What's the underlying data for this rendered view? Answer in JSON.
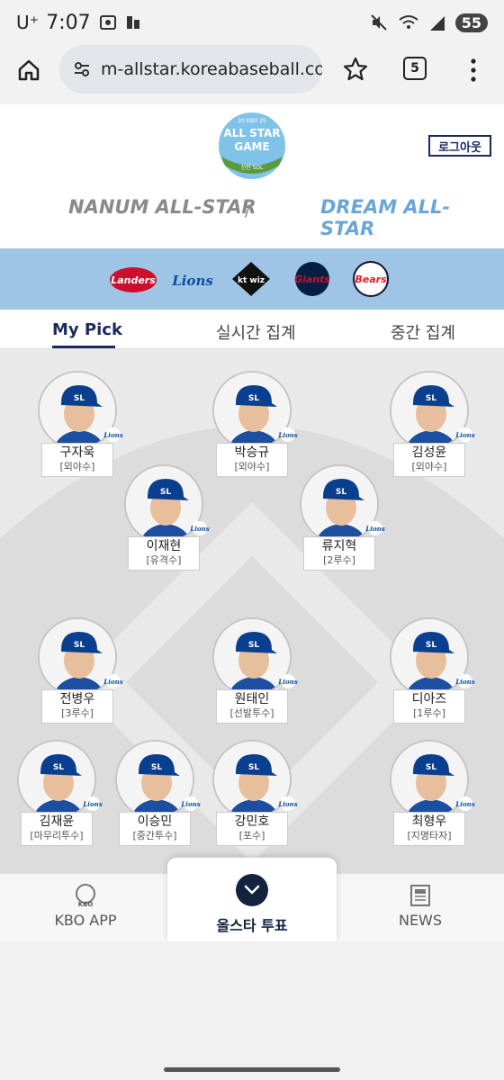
{
  "status_bar": {
    "carrier": "U⁺",
    "time": "7:07",
    "battery": "55"
  },
  "browser": {
    "url": "m-allstar.koreabaseball.com/V",
    "tab_count": "5"
  },
  "header": {
    "logo_top": "20 KBO 25",
    "logo_line1": "ALL STAR",
    "logo_line2": "GAME",
    "logo_sponsor": "신한 SOL",
    "logout_label": "로그아웃",
    "league_nanum": "NANUM ALL-STAR",
    "league_dream": "DREAM ALL-STAR",
    "separator": "/"
  },
  "teams": [
    "Landers",
    "Lions",
    "kt wiz",
    "Giants",
    "Bears"
  ],
  "tabs": {
    "my_pick": "My Pick",
    "realtime": "실시간 집계",
    "interim": "중간 집계"
  },
  "players": [
    {
      "name": "구자욱",
      "position": "[외야수]"
    },
    {
      "name": "박승규",
      "position": "[외야수]"
    },
    {
      "name": "김성윤",
      "position": "[외야수]"
    },
    {
      "name": "이재현",
      "position": "[유격수]"
    },
    {
      "name": "류지혁",
      "position": "[2루수]"
    },
    {
      "name": "전병우",
      "position": "[3루수]"
    },
    {
      "name": "원태인",
      "position": "[선발투수]"
    },
    {
      "name": "디아즈",
      "position": "[1루수]"
    },
    {
      "name": "김재윤",
      "position": "[마무리투수]"
    },
    {
      "name": "이승민",
      "position": "[중간투수]"
    },
    {
      "name": "강민호",
      "position": "[포수]"
    },
    {
      "name": "최형우",
      "position": "[지명타자]"
    }
  ],
  "badge_text": "Lions",
  "cap_text": "SL",
  "bottom_nav": {
    "kbo_app": "KBO APP",
    "kbo_logo": "KBO",
    "vote": "올스타 투표",
    "news": "NEWS"
  },
  "colors": {
    "navy": "#1b2a5b",
    "strip": "#9ec5e6",
    "dream": "#6aa7d6"
  }
}
